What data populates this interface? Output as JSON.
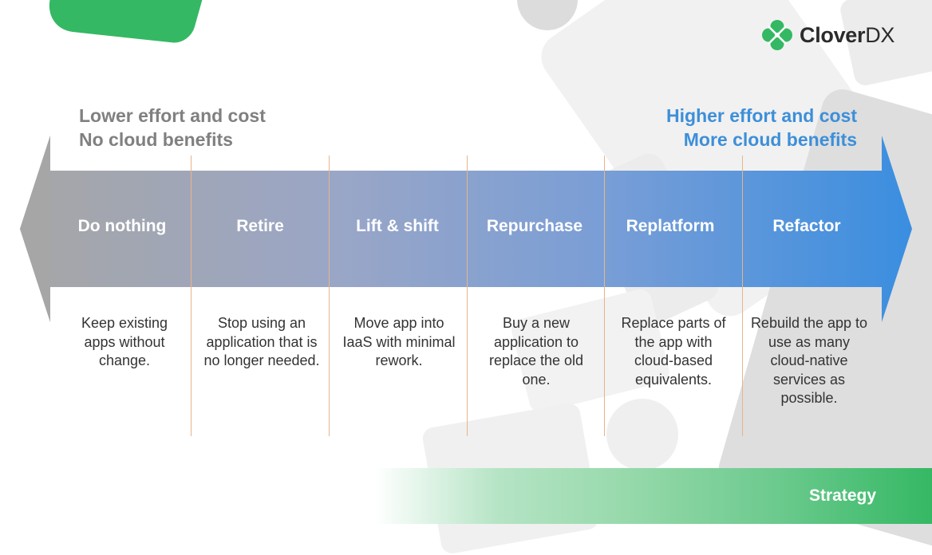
{
  "brand": {
    "name_bold": "Clover",
    "name_light": "DX",
    "accent_green": "#35b864",
    "accent_blue": "#3d8fd9"
  },
  "headers": {
    "left": {
      "line1": "Lower effort and cost",
      "line2": "No cloud benefits"
    },
    "right": {
      "line1": "Higher effort and cost",
      "line2": "More cloud benefits"
    }
  },
  "stages": [
    {
      "label": "Do nothing",
      "description": "Keep existing apps without change."
    },
    {
      "label": "Retire",
      "description": "Stop using an application that is no longer needed."
    },
    {
      "label": "Lift & shift",
      "description": "Move app into IaaS with minimal rework."
    },
    {
      "label": "Repurchase",
      "description": "Buy a new application to replace the old one."
    },
    {
      "label": "Replatform",
      "description": "Replace parts of the app with cloud-based equivalents."
    },
    {
      "label": "Refactor",
      "description": "Rebuild the app to use as many cloud-native services as possible."
    }
  ],
  "arrow": {
    "color_start": "#a6a6a6",
    "color_end": "#3a8ee0"
  },
  "footer": {
    "label": "Strategy"
  }
}
